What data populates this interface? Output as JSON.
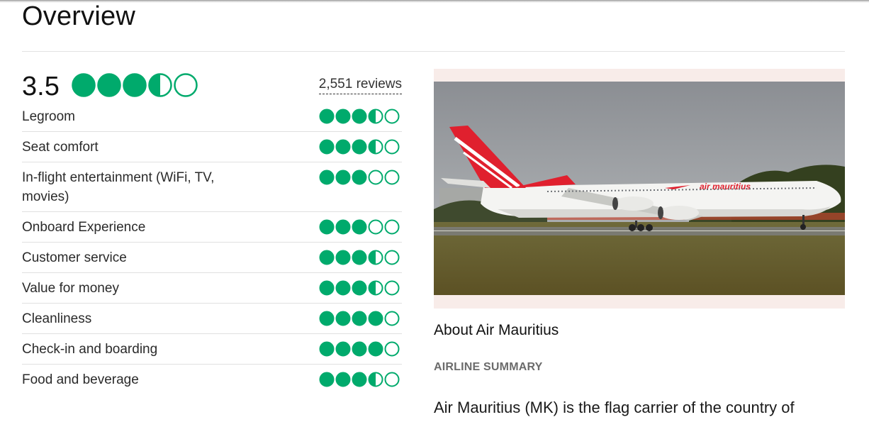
{
  "page": {
    "title": "Overview"
  },
  "rating": {
    "score": "3.5",
    "bubble_value": 3.5,
    "reviews_label": "2,551 reviews"
  },
  "categories": [
    {
      "label": "Legroom",
      "value": 3.5
    },
    {
      "label": "Seat comfort",
      "value": 3.5
    },
    {
      "label": "In-flight entertainment (WiFi, TV, movies)",
      "value": 3
    },
    {
      "label": "Onboard Experience",
      "value": 3
    },
    {
      "label": "Customer service",
      "value": 3.5
    },
    {
      "label": "Value for money",
      "value": 3.5
    },
    {
      "label": "Cleanliness",
      "value": 4
    },
    {
      "label": "Check-in and boarding",
      "value": 4
    },
    {
      "label": "Food and beverage",
      "value": 3.5
    }
  ],
  "about": {
    "title": "About Air Mauritius",
    "section_label": "AIRLINE SUMMARY",
    "summary_text": "Air Mauritius (MK) is the flag carrier of the country of",
    "photo_icon": "airplane-photo",
    "aircraft_livery_text": "air mauritius"
  },
  "colors": {
    "bubble_green": "#00aa6c",
    "photo_frame": "#f8ece9",
    "livery_red": "#e0202e"
  }
}
